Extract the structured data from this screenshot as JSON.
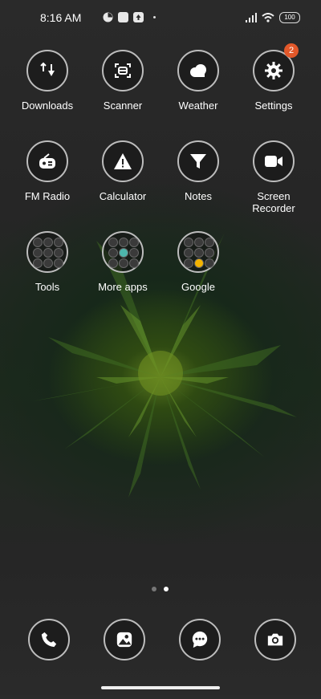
{
  "status_bar": {
    "time": "8:16 AM",
    "battery": "100"
  },
  "apps": [
    {
      "label": "Downloads",
      "icon": "downloads-icon"
    },
    {
      "label": "Scanner",
      "icon": "scanner-icon"
    },
    {
      "label": "Weather",
      "icon": "weather-icon"
    },
    {
      "label": "Settings",
      "icon": "gear-icon",
      "badge": "2"
    },
    {
      "label": "FM Radio",
      "icon": "radio-icon"
    },
    {
      "label": "Calculator",
      "icon": "warning-icon"
    },
    {
      "label": "Notes",
      "icon": "notes-funnel-icon"
    },
    {
      "label": "Screen Recorder",
      "icon": "video-camera-icon"
    },
    {
      "label": "Tools",
      "icon": "folder-icon"
    },
    {
      "label": "More apps",
      "icon": "folder-icon"
    },
    {
      "label": "Google",
      "icon": "folder-icon"
    }
  ],
  "dock": [
    {
      "icon": "phone-icon"
    },
    {
      "icon": "gallery-icon"
    },
    {
      "icon": "messages-icon"
    },
    {
      "icon": "camera-icon"
    }
  ],
  "pager": {
    "pages": 2,
    "active": 2
  },
  "colors": {
    "badge": "#e2582a",
    "ring": "#bdbdbd"
  }
}
